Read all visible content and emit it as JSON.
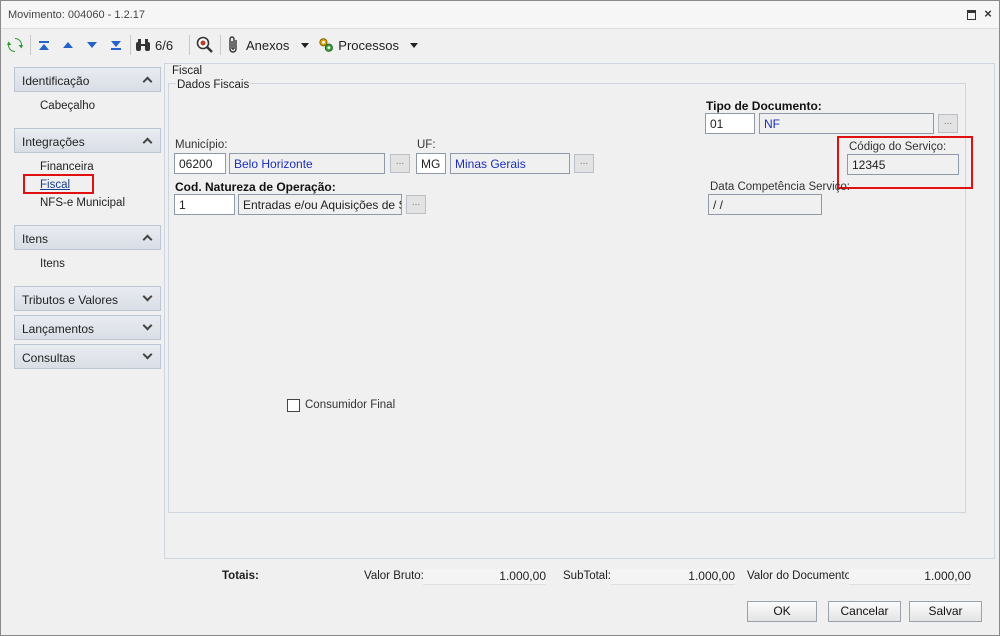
{
  "window": {
    "title": "Movimento: 004060 - 1.2.17"
  },
  "toolbar": {
    "record_counter": "6/6",
    "anexos_label": "Anexos",
    "processos_label": "Processos"
  },
  "sidebar": {
    "groups": [
      {
        "label": "Identificação",
        "items": [
          {
            "label": "Cabeçalho"
          }
        ]
      },
      {
        "label": "Integrações",
        "items": [
          {
            "label": "Financeira"
          },
          {
            "label": "Fiscal"
          },
          {
            "label": "NFS-e Municipal"
          }
        ]
      },
      {
        "label": "Itens",
        "items": [
          {
            "label": "Itens"
          }
        ]
      },
      {
        "label": "Tributos e Valores",
        "items": []
      },
      {
        "label": "Lançamentos",
        "items": []
      },
      {
        "label": "Consultas",
        "items": []
      }
    ]
  },
  "form": {
    "tab_title": "Fiscal",
    "section_title": "Dados Fiscais",
    "tipo_documento": {
      "label": "Tipo de Documento:",
      "code": "01",
      "desc": "NF"
    },
    "municipio": {
      "label": "Município:",
      "code": "06200",
      "desc": "Belo Horizonte"
    },
    "uf": {
      "label": "UF:",
      "code": "MG",
      "desc": "Minas Gerais"
    },
    "codigo_servico": {
      "label": "Código do Serviço:",
      "value": "12345"
    },
    "natureza": {
      "label": "Cod. Natureza de Operação:",
      "code": "1",
      "desc": "Entradas e/ou Aquisições de Ser"
    },
    "data_competencia": {
      "label": "Data Competência Serviço:",
      "value": " / /"
    },
    "consumidor_final": {
      "label": "Consumidor Final",
      "checked": false
    },
    "lookup_glyph": "..."
  },
  "totals": {
    "label": "Totais:",
    "valor_bruto_label": "Valor Bruto:",
    "valor_bruto": "1.000,00",
    "subtotal_label": "SubTotal:",
    "subtotal": "1.000,00",
    "valor_documento_label": "Valor do Documento:",
    "valor_documento": "1.000,00"
  },
  "buttons": {
    "ok": "OK",
    "cancel": "Cancelar",
    "save": "Salvar"
  },
  "colors": {
    "highlight": "#e01010",
    "link_blue": "#1c2fb8",
    "icon_blue": "#2563c9"
  }
}
